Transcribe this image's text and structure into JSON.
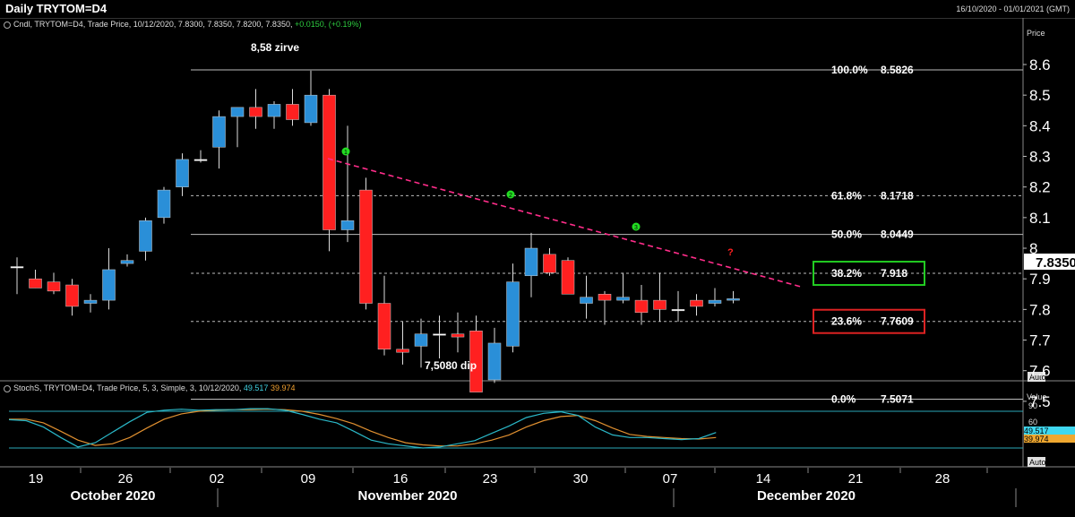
{
  "window": {
    "title": "Daily TRYTOM=D4",
    "date_range": "16/10/2020 - 01/01/2021 (GMT)"
  },
  "main_legend": {
    "label": "Cndl, TRYTOM=D4, Trade Price, 10/12/2020, 7.8300, 7.8350, 7.8200, 7.8350,",
    "change": "+0.0150, (+0.19%)"
  },
  "stoch_legend": {
    "label": "StochS, TRYTOM=D4, Trade Price,  5, 3, Simple, 3, 10/12/2020,",
    "k": "49.517",
    "d": "39.974"
  },
  "price_axis": {
    "title": "Price",
    "last_price": "7.8350",
    "auto_label": "Auto",
    "ticks": [
      "8.6",
      "8.5",
      "8.4",
      "8.3",
      "8.2",
      "8.1",
      "8",
      "7.9",
      "7.8",
      "7.7",
      "7.6",
      "7.5"
    ]
  },
  "stoch_axis": {
    "title": "Value",
    "ticks": [
      "90",
      "60"
    ],
    "k_value": "49.517",
    "d_value": "39.974",
    "auto_label": "Auto"
  },
  "x_axis": {
    "day_labels": [
      "19",
      "26",
      "02",
      "09",
      "16",
      "23",
      "30",
      "07",
      "14",
      "21",
      "28"
    ],
    "month_labels": [
      "October 2020",
      "November 2020",
      "December 2020"
    ]
  },
  "annotations": {
    "peak": "8,58 zirve",
    "dip": "7,5080 dip",
    "markers": [
      "1",
      "2",
      "3"
    ],
    "question": "?"
  },
  "fib_levels": [
    {
      "pct": "100.0%",
      "value": "8.5826",
      "price": 8.5826,
      "box": ""
    },
    {
      "pct": "61.8%",
      "value": "8.1718",
      "price": 8.1718,
      "box": ""
    },
    {
      "pct": "50.0%",
      "value": "8.0449",
      "price": 8.0449,
      "box": ""
    },
    {
      "pct": "38.2%",
      "value": "7.918",
      "price": 7.918,
      "box": "#22cc22"
    },
    {
      "pct": "23.6%",
      "value": "7.7609",
      "price": 7.7609,
      "box": "#dd2222"
    },
    {
      "pct": "0.0%",
      "value": "7.5071",
      "price": 7.5071,
      "box": ""
    }
  ],
  "colors": {
    "up": "#2a8fd8",
    "down": "#ff2020",
    "trendline": "#ff2d8a",
    "k_line": "#2ab8c8",
    "d_line": "#e09030",
    "marker": "#22dd22"
  },
  "chart_data": {
    "type": "candlestick",
    "title": "Daily TRYTOM=D4",
    "ylim": [
      7.43,
      8.65
    ],
    "dates": [
      "2020-10-16",
      "2020-10-19",
      "2020-10-20",
      "2020-10-21",
      "2020-10-22",
      "2020-10-23",
      "2020-10-26",
      "2020-10-27",
      "2020-10-28",
      "2020-10-29",
      "2020-10-30",
      "2020-11-02",
      "2020-11-03",
      "2020-11-04",
      "2020-11-05",
      "2020-11-06",
      "2020-11-09",
      "2020-11-10",
      "2020-11-11",
      "2020-11-12",
      "2020-11-13",
      "2020-11-16",
      "2020-11-17",
      "2020-11-18",
      "2020-11-19",
      "2020-11-20",
      "2020-11-23",
      "2020-11-24",
      "2020-11-25",
      "2020-11-26",
      "2020-11-27",
      "2020-11-30",
      "2020-12-01",
      "2020-12-02",
      "2020-12-03",
      "2020-12-04",
      "2020-12-07",
      "2020-12-08",
      "2020-12-09",
      "2020-12-10"
    ],
    "open": [
      7.94,
      7.9,
      7.89,
      7.88,
      7.82,
      7.83,
      7.95,
      7.99,
      8.1,
      8.2,
      8.29,
      8.33,
      8.43,
      8.46,
      8.43,
      8.47,
      8.41,
      8.5,
      8.06,
      8.19,
      7.82,
      7.67,
      7.68,
      7.72,
      7.72,
      7.73,
      7.57,
      7.68,
      7.91,
      7.98,
      7.96,
      7.82,
      7.85,
      7.83,
      7.83,
      7.83,
      7.8,
      7.83,
      7.82,
      7.83
    ],
    "high": [
      7.97,
      7.93,
      7.92,
      7.9,
      7.85,
      8.0,
      7.98,
      8.1,
      8.2,
      8.31,
      8.32,
      8.45,
      8.46,
      8.52,
      8.48,
      8.52,
      8.58,
      8.52,
      8.4,
      8.23,
      7.91,
      7.76,
      7.77,
      7.78,
      7.79,
      7.78,
      7.74,
      7.95,
      8.05,
      8.0,
      7.97,
      7.91,
      7.86,
      7.92,
      7.88,
      7.92,
      7.86,
      7.85,
      7.87,
      7.86
    ],
    "low": [
      7.85,
      7.87,
      7.85,
      7.78,
      7.79,
      7.8,
      7.94,
      7.96,
      8.08,
      8.17,
      8.28,
      8.26,
      8.33,
      8.39,
      8.39,
      8.4,
      8.4,
      7.99,
      8.02,
      7.8,
      7.65,
      7.62,
      7.61,
      7.64,
      7.66,
      7.55,
      7.56,
      7.66,
      7.84,
      7.91,
      7.86,
      7.77,
      7.75,
      7.82,
      7.75,
      7.76,
      7.76,
      7.78,
      7.81,
      7.82
    ],
    "close": [
      7.94,
      7.87,
      7.86,
      7.81,
      7.83,
      7.93,
      7.96,
      8.09,
      8.19,
      8.29,
      8.29,
      8.43,
      8.46,
      8.43,
      8.47,
      8.42,
      8.5,
      8.06,
      8.09,
      7.82,
      7.67,
      7.66,
      7.72,
      7.72,
      7.71,
      7.53,
      7.69,
      7.89,
      8.0,
      7.92,
      7.85,
      7.84,
      7.83,
      7.84,
      7.79,
      7.8,
      7.8,
      7.81,
      7.83,
      7.835
    ],
    "stoch_k": [
      74,
      72,
      60,
      40,
      22,
      30,
      50,
      70,
      88,
      92,
      94,
      92,
      93,
      93,
      95,
      95,
      92,
      84,
      75,
      68,
      52,
      35,
      28,
      24,
      20,
      22,
      28,
      34,
      48,
      62,
      78,
      86,
      89,
      82,
      60,
      45,
      40,
      40,
      38,
      36,
      38,
      49.517
    ],
    "stoch_d": [
      75,
      75,
      68,
      52,
      35,
      25,
      28,
      40,
      58,
      75,
      85,
      90,
      92,
      93,
      93,
      94,
      93,
      90,
      84,
      76,
      66,
      52,
      40,
      30,
      26,
      24,
      24,
      28,
      35,
      45,
      60,
      72,
      80,
      82,
      72,
      58,
      46,
      42,
      40,
      38,
      37,
      39.974
    ]
  }
}
